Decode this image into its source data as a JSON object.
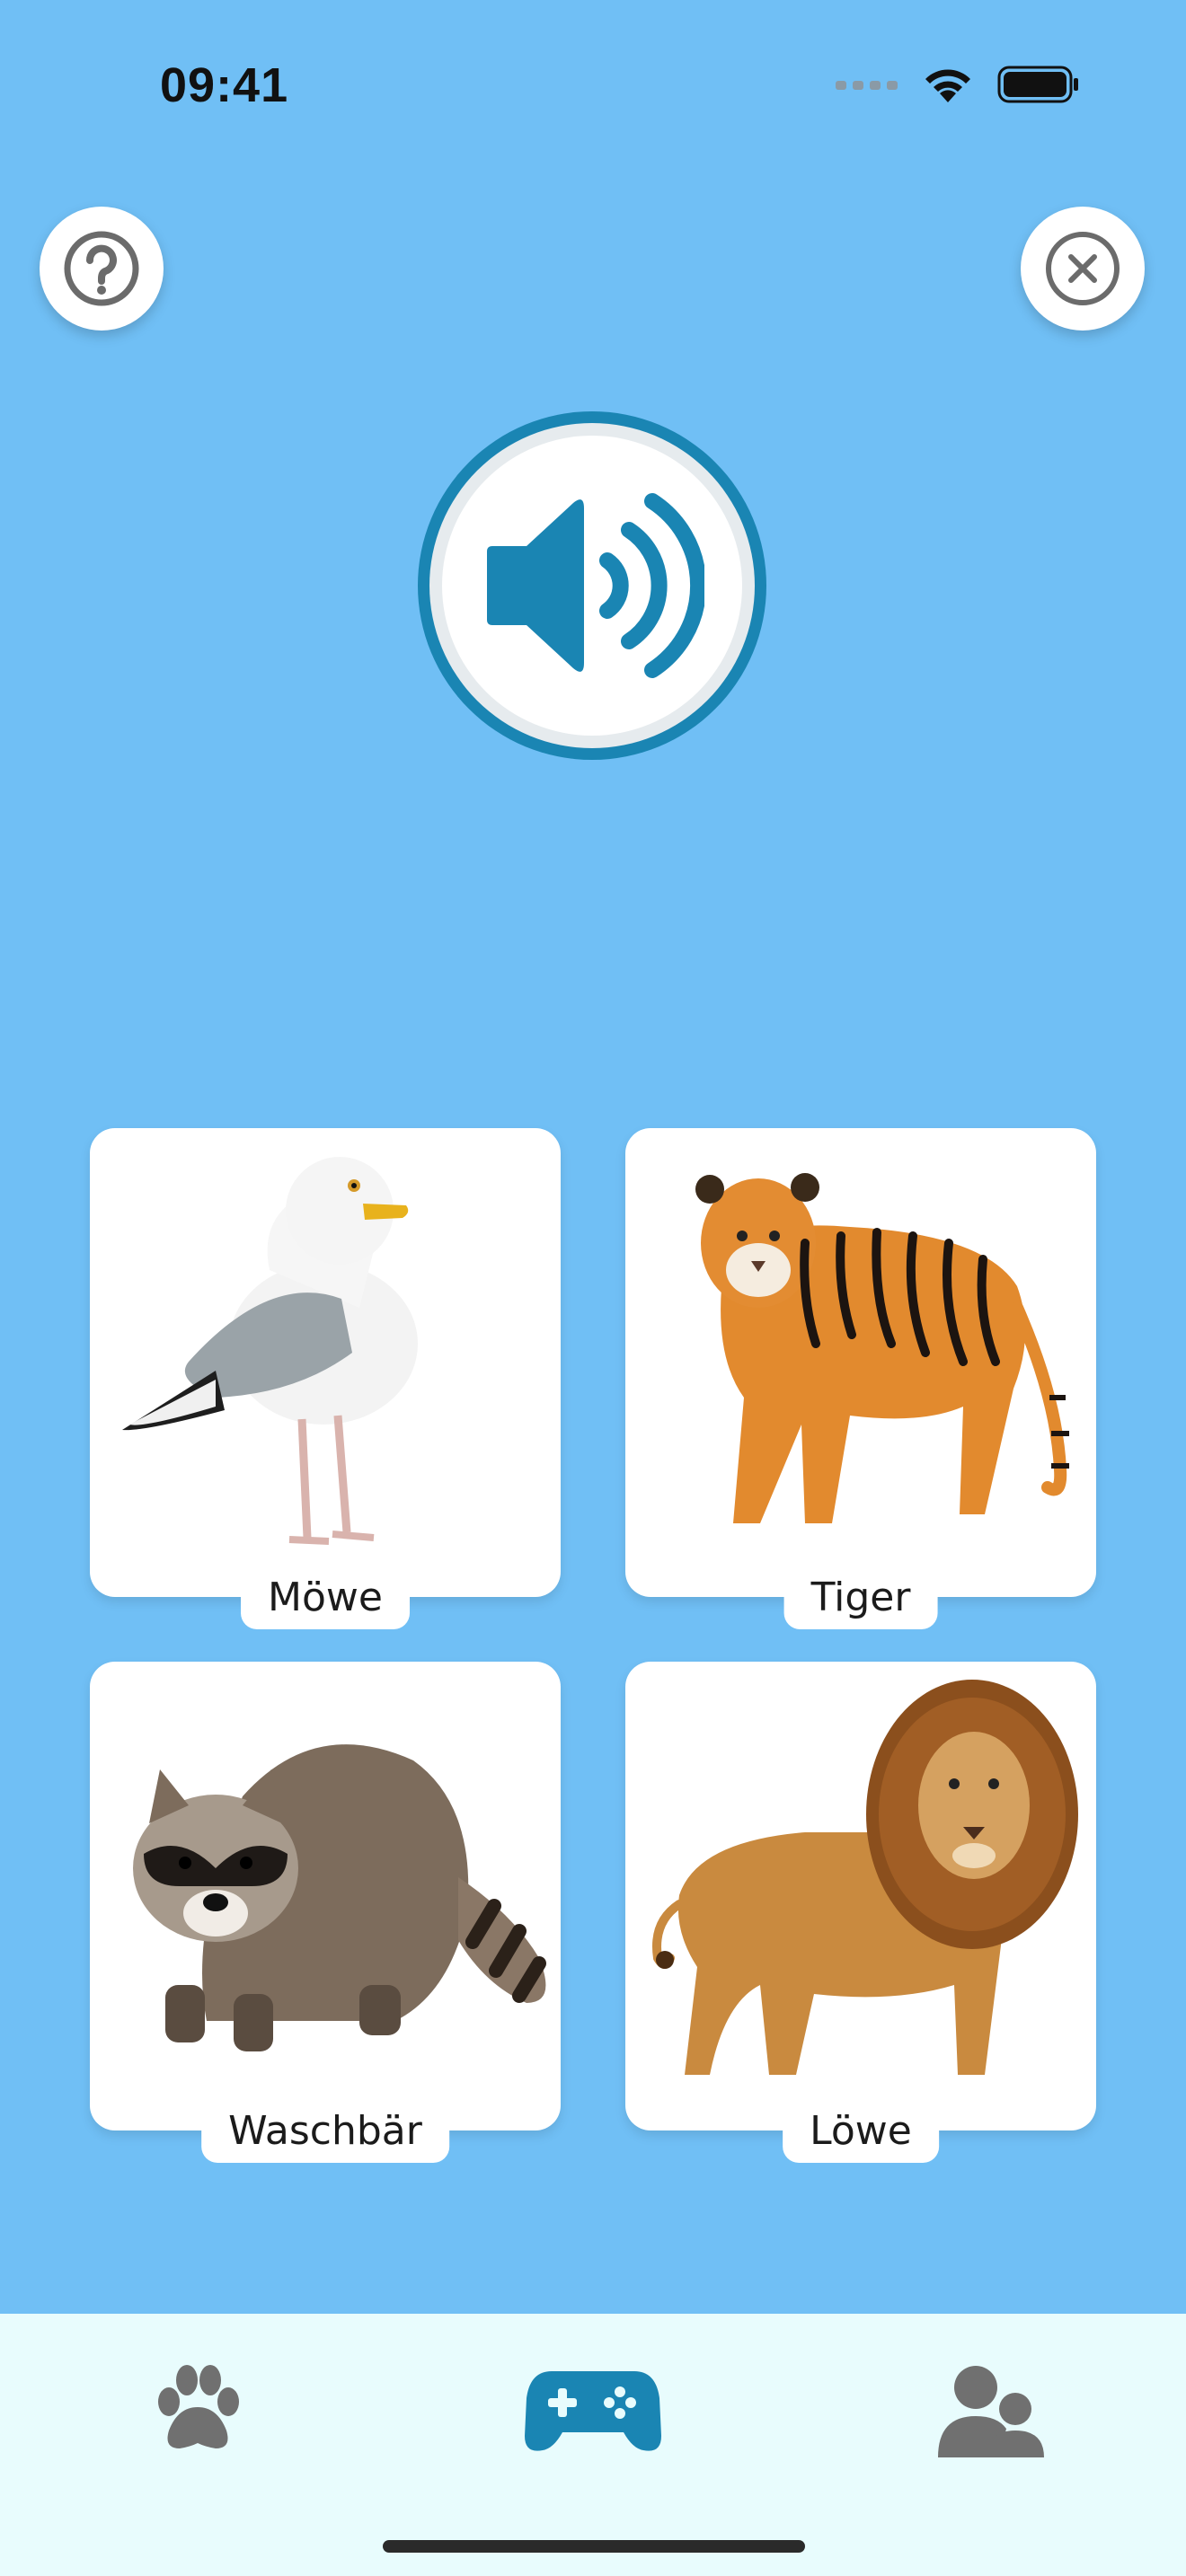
{
  "status_bar": {
    "time": "09:41"
  },
  "colors": {
    "background": "#70bff5",
    "accent": "#1a85b3",
    "tabbar": "#e8fcfd",
    "icon_gray": "#707070"
  },
  "buttons": {
    "help": "question-icon",
    "close": "close-icon",
    "play_sound": "speaker-icon"
  },
  "cards": [
    {
      "label": "Möwe"
    },
    {
      "label": "Tiger"
    },
    {
      "label": "Waschbär"
    },
    {
      "label": "Löwe"
    }
  ],
  "tabbar": {
    "tabs": [
      {
        "icon": "paw-icon",
        "active": false
      },
      {
        "icon": "gamepad-icon",
        "active": true
      },
      {
        "icon": "users-icon",
        "active": false
      }
    ]
  }
}
